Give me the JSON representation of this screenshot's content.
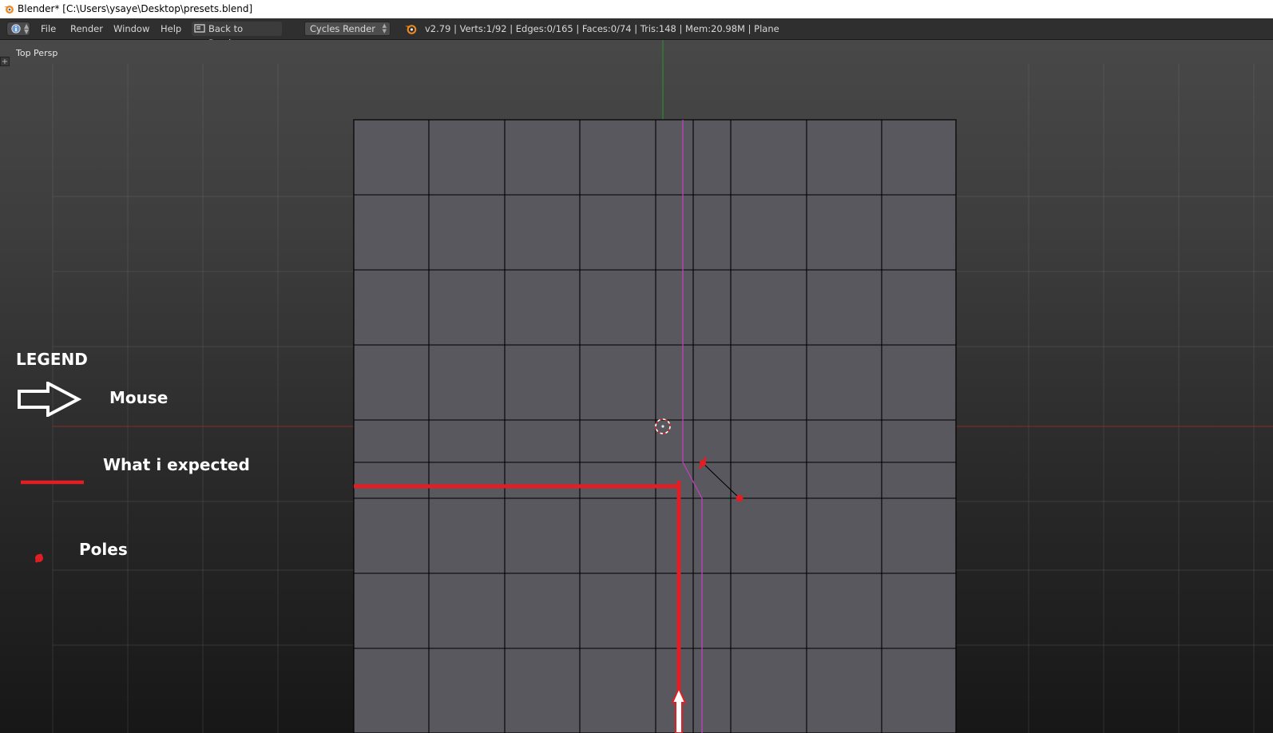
{
  "window": {
    "title": "Blender* [C:\\Users\\ysaye\\Desktop\\presets.blend]"
  },
  "header": {
    "editor_type_icon": "info-icon",
    "menus": [
      "File",
      "Render",
      "Window",
      "Help"
    ],
    "back_button": "Back to Previous",
    "render_engine": "Cycles Render",
    "stats": "v2.79 | Verts:1/92 | Edges:0/165 | Faces:0/74 | Tris:148 | Mem:20.98M | Plane"
  },
  "viewport": {
    "view_label": "Top Persp",
    "plus_label": "+"
  },
  "legend": {
    "title": "LEGEND",
    "items": [
      {
        "label": "Mouse",
        "icon": "arrow-icon"
      },
      {
        "label": "What i expected",
        "icon": "red-line-icon"
      },
      {
        "label": "Poles",
        "icon": "pole-icon"
      }
    ]
  },
  "colors": {
    "mesh_face": "#59585e",
    "mesh_edge": "#000000",
    "loop_cut_preview": "#c040c0",
    "annotation_red": "#e01e24",
    "y_axis": "#2e8a2e",
    "x_axis": "#8a2a2a"
  }
}
